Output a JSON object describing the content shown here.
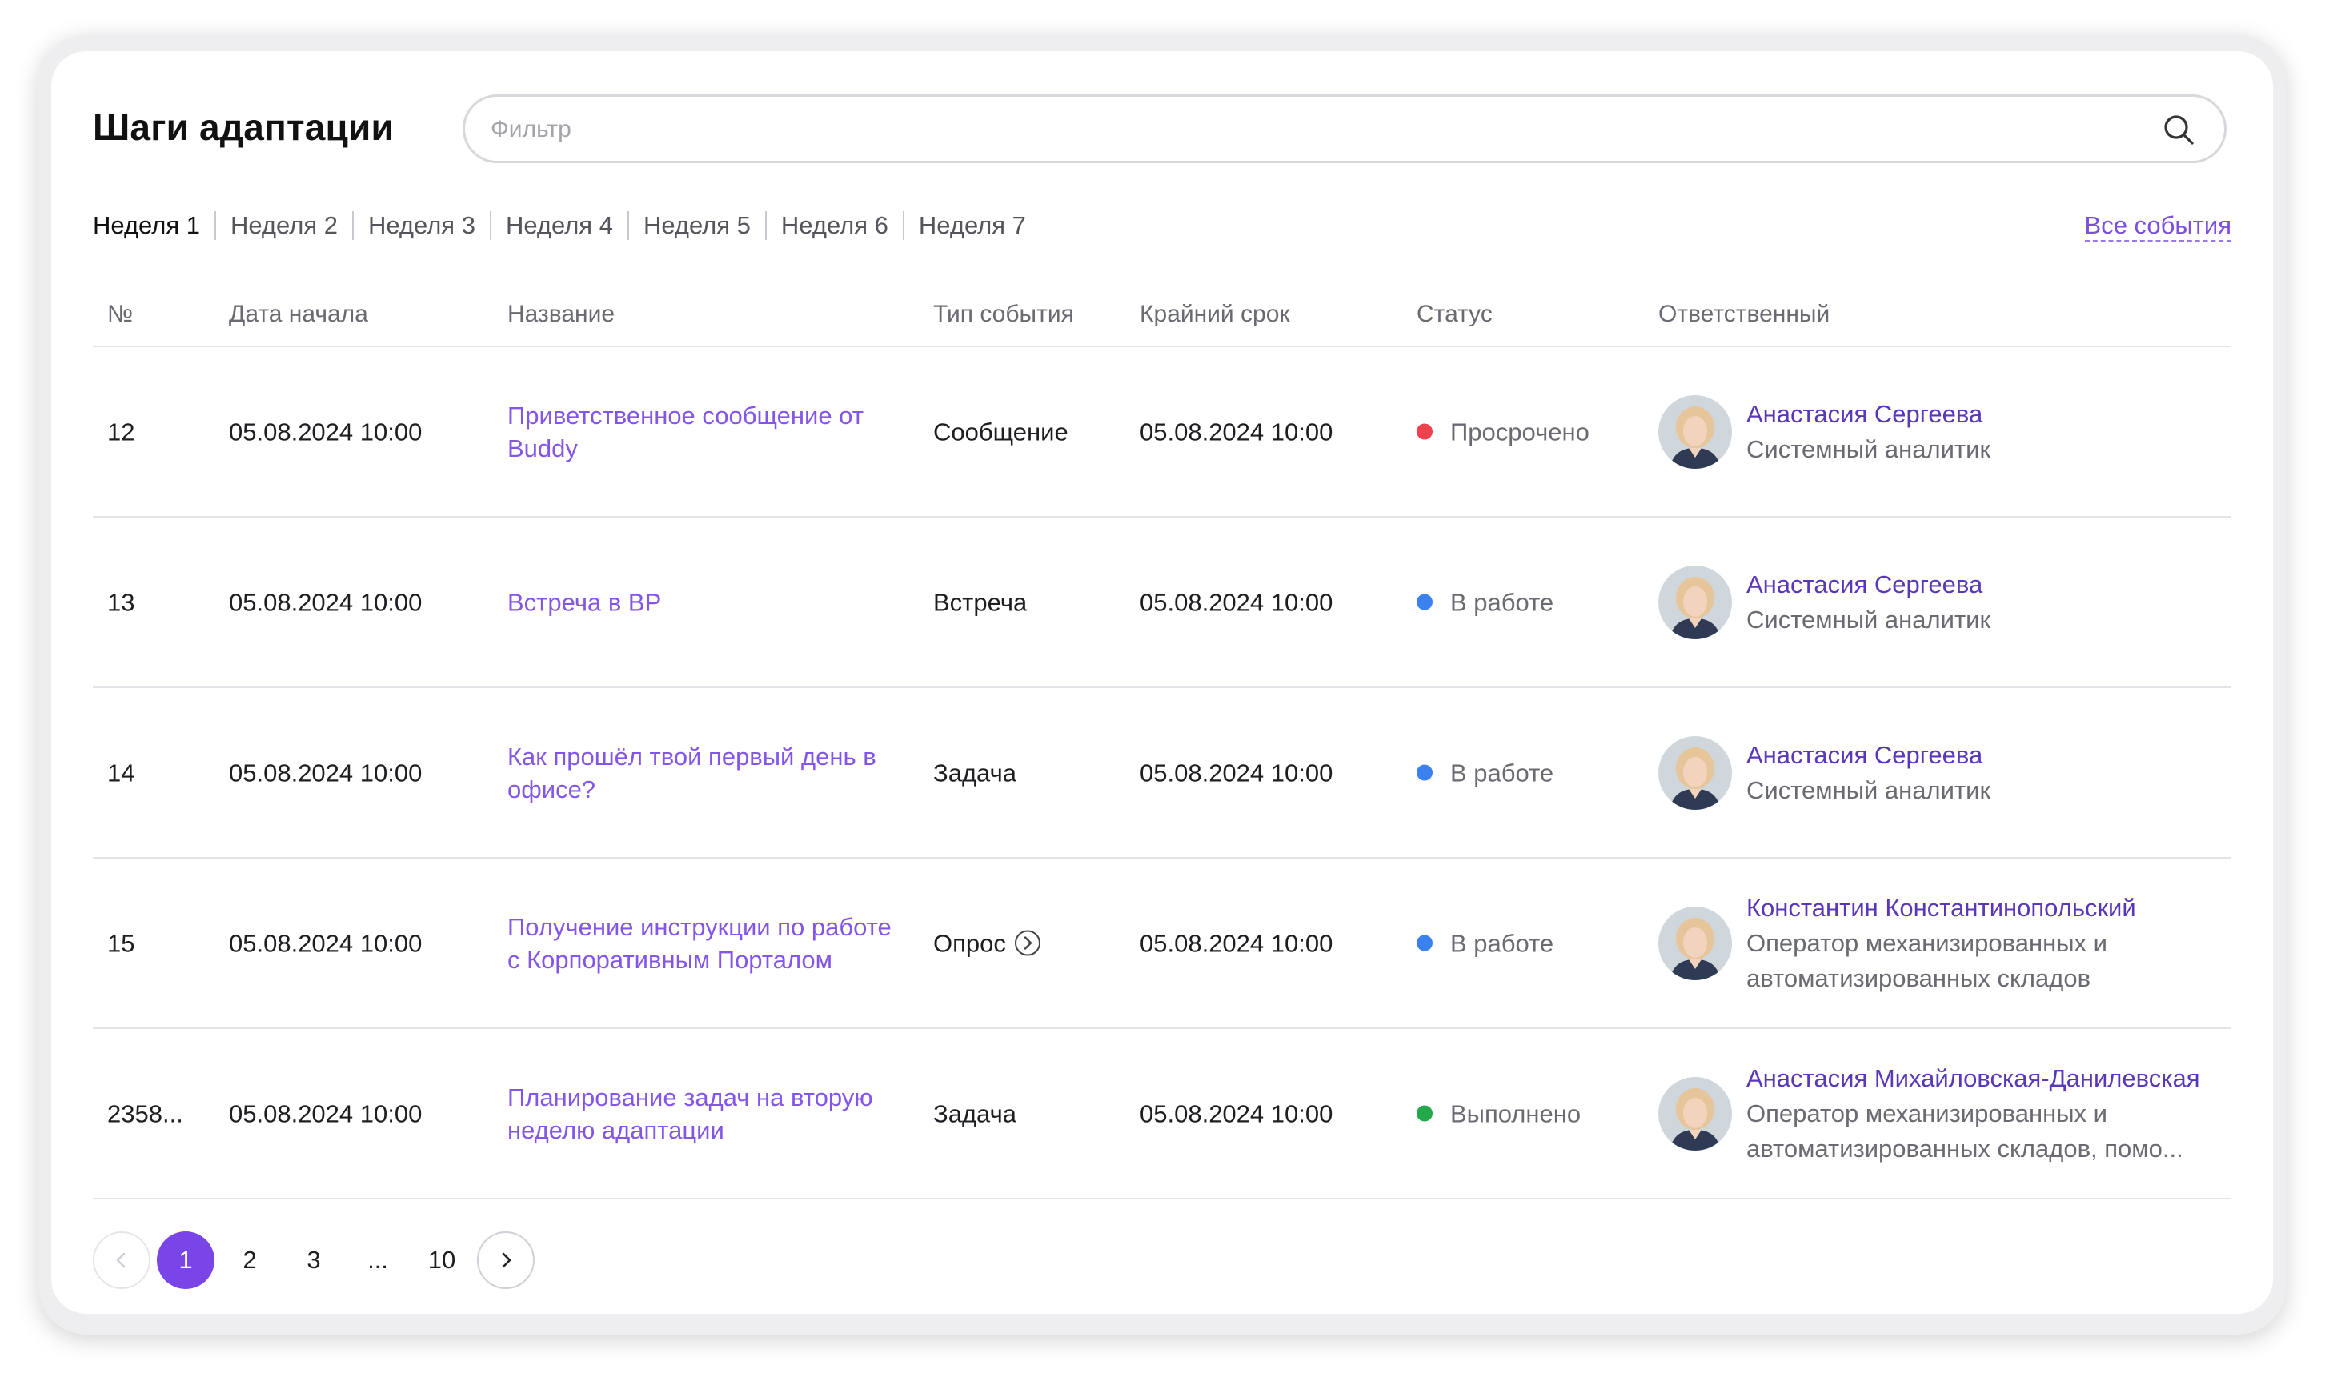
{
  "header": {
    "title": "Шаги адаптации",
    "filter_placeholder": "Фильтр",
    "search_icon": "search-icon"
  },
  "weeks": {
    "items": [
      "Неделя 1",
      "Неделя 2",
      "Неделя 3",
      "Неделя 4",
      "Неделя 5",
      "Неделя 6",
      "Неделя 7"
    ],
    "selected": "Неделя 1",
    "all_events_label": "Все события"
  },
  "table": {
    "columns": [
      "№",
      "Дата начала",
      "Название",
      "Тип события",
      "Крайний срок",
      "Статус",
      "Ответственный"
    ],
    "rows": [
      {
        "num": "12",
        "start": "05.08.2024 10:00",
        "name": "Приветственное сообщение от Buddy",
        "type": "Сообщение",
        "deadline": "05.08.2024 10:00",
        "status": "Просрочено",
        "status_color": "#f0414f",
        "resp_name": "Анастасия Сергеева",
        "resp_role": "Системный аналитик"
      },
      {
        "num": "13",
        "start": "05.08.2024 10:00",
        "name": "Встреча в BP",
        "type": "Встреча",
        "deadline": "05.08.2024 10:00",
        "status": "В работе",
        "status_color": "#3b82f0",
        "resp_name": "Анастасия Сергеева",
        "resp_role": "Системный аналитик"
      },
      {
        "num": "14",
        "start": "05.08.2024 10:00",
        "name": "Как прошёл твой первый день в офисе?",
        "type": "Задача",
        "deadline": "05.08.2024 10:00",
        "status": "В работе",
        "status_color": "#3b82f0",
        "resp_name": "Анастасия Сергеева",
        "resp_role": "Системный аналитик"
      },
      {
        "num": "15",
        "start": "05.08.2024 10:00",
        "name": "Получение инструкции по работе с Корпоративным Порталом",
        "type": "Опрос",
        "type_icon": "chevron-right-circle-icon",
        "deadline": "05.08.2024 10:00",
        "status": "В работе",
        "status_color": "#3b82f0",
        "resp_name": "Константин Константинопольский",
        "resp_role": "Оператор механизированных и автоматизированных складов"
      },
      {
        "num": "2358...",
        "start": "05.08.2024 10:00",
        "name": "Планирование задач на вторую неделю адаптации",
        "type": "Задача",
        "deadline": "05.08.2024 10:00",
        "status": "Выполнено",
        "status_color": "#23a949",
        "resp_name": "Анастасия Михайловская-Данилевская",
        "resp_role": "Оператор механизированных и автоматизированных складов, помо..."
      }
    ]
  },
  "pagination": {
    "prev_icon": "chevron-left-icon",
    "next_icon": "chevron-right-icon",
    "pages": [
      "1",
      "2",
      "3",
      "...",
      "10"
    ],
    "current": "1",
    "accent": "#7a45e6"
  },
  "colors": {
    "link": "#8456e8",
    "resp_name": "#5a37b8"
  }
}
